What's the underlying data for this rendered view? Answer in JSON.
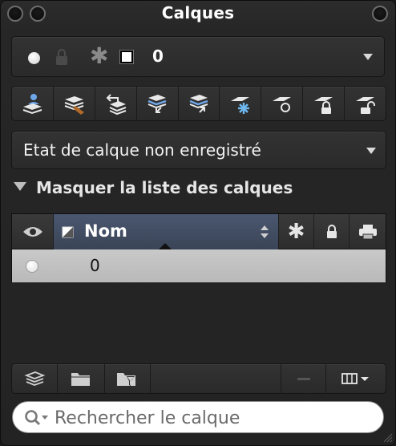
{
  "window": {
    "title": "Calques"
  },
  "current_layer": {
    "name": "0"
  },
  "toolbar": {
    "items": [
      "new-layer",
      "purge-layer",
      "layer-previous",
      "layer-match",
      "layer-transfer",
      "freeze-layer",
      "layer-off",
      "lock-layer",
      "unlock-layer"
    ]
  },
  "layer_state": {
    "value": "Etat de calque non enregistré"
  },
  "section": {
    "label": "Masquer la liste des calques"
  },
  "table": {
    "header_name": "Nom",
    "rows": [
      {
        "name": "0"
      }
    ]
  },
  "search": {
    "placeholder": "Rechercher le calque"
  },
  "colors": {
    "accent": "#3a4456",
    "row_selected": "#c4c4c4",
    "panel": "#262626"
  }
}
